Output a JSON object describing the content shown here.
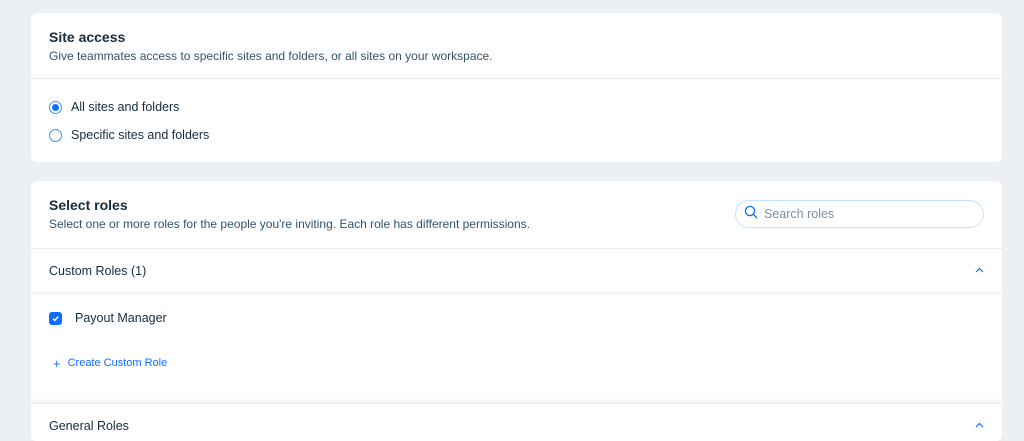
{
  "site_access": {
    "title": "Site access",
    "subtitle": "Give teammates access to specific sites and folders, or all sites on your workspace.",
    "options": [
      {
        "label": "All sites and folders",
        "selected": true
      },
      {
        "label": "Specific sites and folders",
        "selected": false
      }
    ]
  },
  "select_roles": {
    "title": "Select roles",
    "subtitle": "Select one or more roles for the people you're inviting. Each role has different permissions.",
    "search_placeholder": "Search roles",
    "custom_roles": {
      "label": "Custom Roles (1)",
      "expanded": true,
      "roles": [
        {
          "label": "Payout Manager",
          "checked": true
        }
      ],
      "create_label": "Create Custom Role"
    },
    "general_roles": {
      "label": "General Roles",
      "expanded": true
    }
  },
  "colors": {
    "accent": "#116dff",
    "background": "#eceff3",
    "text": "#162d3d"
  }
}
